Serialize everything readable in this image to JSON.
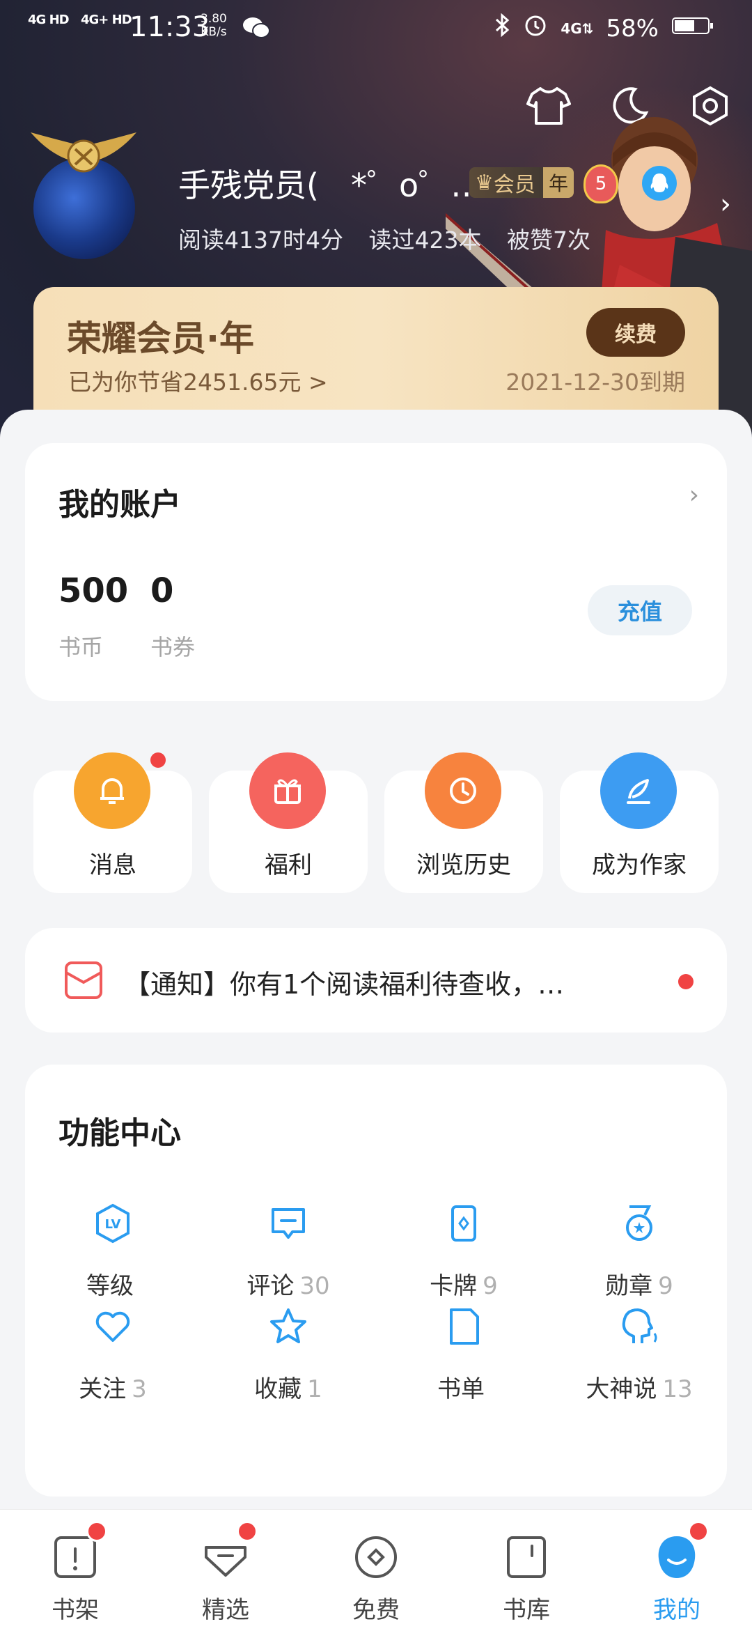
{
  "status_bar": {
    "signal1": "4G HD",
    "signal2": "4G+ HD",
    "time": "11:33",
    "speed_value": "3.80",
    "speed_unit": "KB/s",
    "battery": "58%"
  },
  "profile": {
    "username": "手残党员(　*゜ο゜…",
    "vip_badge": "会员",
    "vip_badge_year": "年",
    "level": "5",
    "read_time": "阅读4137时4分",
    "books_read": "读过423本",
    "liked": "被赞7次"
  },
  "vip_card": {
    "title": "荣耀会员·年",
    "saved": "已为你节省2451.65元 >",
    "expire": "2021-12-30到期",
    "renew_label": "续费"
  },
  "account": {
    "title": "我的账户",
    "coins_value": "500",
    "coins_label": "书币",
    "vouchers_value": "0",
    "vouchers_label": "书券",
    "charge_label": "充值"
  },
  "quick_actions": [
    {
      "label": "消息",
      "color": "#f7a52f",
      "icon": "bell-icon"
    },
    {
      "label": "福利",
      "color": "#f5645e",
      "icon": "gift-icon"
    },
    {
      "label": "浏览历史",
      "color": "#f7833e",
      "icon": "clock-icon"
    },
    {
      "label": "成为作家",
      "color": "#3d9cf2",
      "icon": "pen-icon"
    }
  ],
  "notice": {
    "text": "【通知】你有1个阅读福利待查收，…"
  },
  "features": {
    "title": "功能中心",
    "items": [
      {
        "label": "等级",
        "count": "",
        "icon": "level-icon"
      },
      {
        "label": "评论",
        "count": "30",
        "icon": "comment-icon"
      },
      {
        "label": "卡牌",
        "count": "9",
        "icon": "card-icon"
      },
      {
        "label": "勋章",
        "count": "9",
        "icon": "medal-icon"
      },
      {
        "label": "关注",
        "count": "3",
        "icon": "heart-icon"
      },
      {
        "label": "收藏",
        "count": "1",
        "icon": "star-icon"
      },
      {
        "label": "书单",
        "count": "",
        "icon": "booklist-icon"
      },
      {
        "label": "大神说",
        "count": "13",
        "icon": "talk-icon"
      }
    ]
  },
  "tabs": [
    {
      "label": "书架",
      "dot": true
    },
    {
      "label": "精选",
      "dot": true
    },
    {
      "label": "免费",
      "dot": false
    },
    {
      "label": "书库",
      "dot": false
    },
    {
      "label": "我的",
      "dot": true
    }
  ],
  "colors": {
    "accent": "#2a9cf0",
    "badge_red": "#f04343",
    "vip_brown": "#5a3418"
  }
}
